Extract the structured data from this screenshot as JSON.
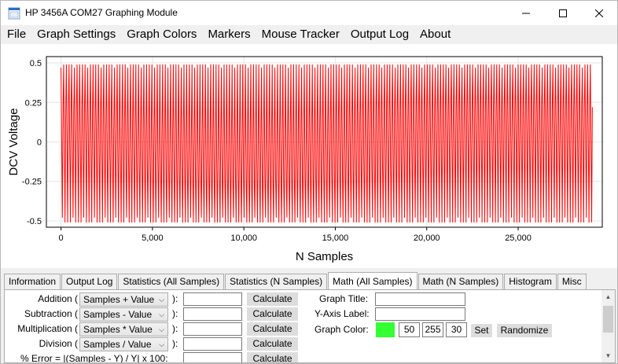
{
  "window": {
    "title": "HP 3456A COM27 Graphing Module"
  },
  "menu": {
    "items": [
      "File",
      "Graph Settings",
      "Graph Colors",
      "Markers",
      "Mouse Tracker",
      "Output Log",
      "About"
    ]
  },
  "chart_data": {
    "type": "line",
    "title": "",
    "xlabel": "N Samples",
    "ylabel": "DCV Voltage",
    "xlim": [
      -800,
      29600
    ],
    "ylim": [
      -0.54,
      0.54
    ],
    "x_ticks": [
      0,
      5000,
      10000,
      15000,
      20000,
      25000
    ],
    "x_tick_labels": [
      "0",
      "5,000",
      "10,000",
      "15,000",
      "20,000",
      "25,000"
    ],
    "y_ticks": [
      0.5,
      0.25,
      0,
      -0.25,
      -0.5
    ],
    "y_tick_labels": [
      "0.5",
      "0.25",
      "0",
      "-0.25",
      "-0.5"
    ],
    "grid": true,
    "series": [
      {
        "color": "#ff0000",
        "description_note": "oscillating square-like signal between about -0.5 and 0.5 over about 29,000 samples",
        "x_range": [
          0,
          29000
        ],
        "y_max": 0.49,
        "y_min": -0.51
      }
    ]
  },
  "tabs": [
    "Information",
    "Output Log",
    "Statistics (All Samples)",
    "Statistics (N Samples)",
    "Math (All Samples)",
    "Math (N Samples)",
    "Histogram",
    "Misc"
  ],
  "active_tab": "Math (All Samples)",
  "math": {
    "rows": [
      {
        "label": "Addition (",
        "combo": "Samples + Value",
        "close": "):",
        "button": "Calculate"
      },
      {
        "label": "Subtraction (",
        "combo": "Samples - Value",
        "close": "):",
        "button": "Calculate"
      },
      {
        "label": "Multiplication (",
        "combo": "Samples * Value",
        "close": "):",
        "button": "Calculate"
      },
      {
        "label": "Division (",
        "combo": "Samples / Value",
        "close": "):",
        "button": "Calculate"
      },
      {
        "label": "% Error = |(Samples - Y) / Y| x 100:",
        "button": "Calculate"
      }
    ],
    "graph_title_label": "Graph Title:",
    "y_axis_label_label": "Y-Axis Label:",
    "graph_color_label": "Graph Color:",
    "color_swatch": "#33ff33",
    "rgb": [
      "50",
      "255",
      "30"
    ],
    "set_button": "Set",
    "randomize_button": "Randomize"
  }
}
